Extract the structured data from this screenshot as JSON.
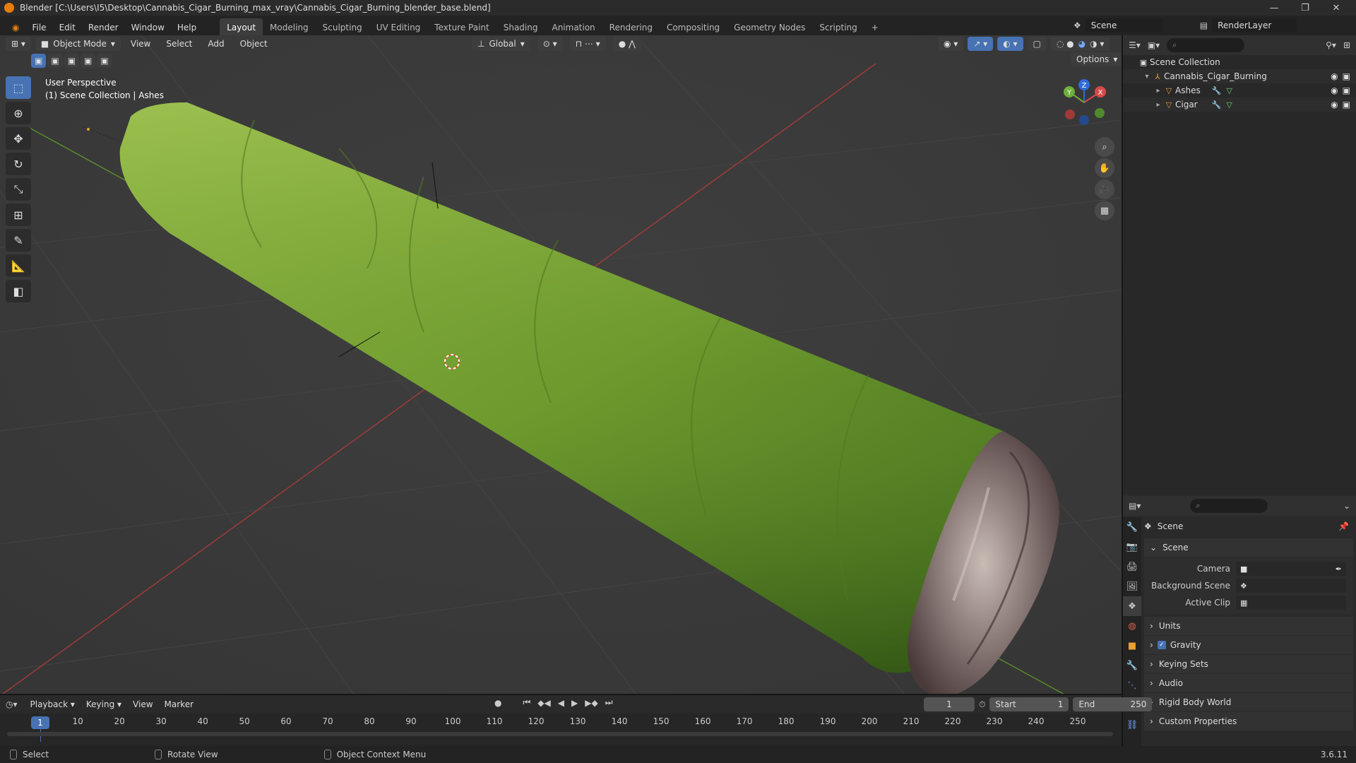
{
  "window": {
    "title": "Blender [C:\\Users\\I5\\Desktop\\Cannabis_Cigar_Burning_max_vray\\Cannabis_Cigar_Burning_blender_base.blend]"
  },
  "menu": [
    "File",
    "Edit",
    "Render",
    "Window",
    "Help"
  ],
  "workspaces": [
    "Layout",
    "Modeling",
    "Sculpting",
    "UV Editing",
    "Texture Paint",
    "Shading",
    "Animation",
    "Rendering",
    "Compositing",
    "Geometry Nodes",
    "Scripting"
  ],
  "active_workspace": "Layout",
  "scene_selector": "Scene",
  "view_layer": "RenderLayer",
  "viewport": {
    "mode": "Object Mode",
    "menus": [
      "View",
      "Select",
      "Add",
      "Object"
    ],
    "transform_orientation": "Global",
    "options_label": "Options",
    "perspective_label": "User Perspective",
    "collection_label": "(1) Scene Collection | Ashes",
    "gizmo_axes": [
      "X",
      "Y",
      "Z"
    ]
  },
  "outliner": {
    "root": "Scene Collection",
    "collection": "Cannabis_Cigar_Burning",
    "objects": [
      "Ashes",
      "Cigar"
    ]
  },
  "properties": {
    "context": "Scene",
    "section": "Scene",
    "fields": [
      {
        "label": "Camera",
        "value": ""
      },
      {
        "label": "Background Scene",
        "value": ""
      },
      {
        "label": "Active Clip",
        "value": ""
      }
    ],
    "panels": [
      "Units",
      "Gravity",
      "Keying Sets",
      "Audio",
      "Rigid Body World",
      "Custom Properties"
    ],
    "gravity_checked": true
  },
  "timeline": {
    "menus": [
      "Playback",
      "Keying",
      "View",
      "Marker"
    ],
    "current_frame": "1",
    "start_label": "Start",
    "start": "1",
    "end_label": "End",
    "end": "250",
    "ticks": [
      "1",
      "10",
      "20",
      "30",
      "40",
      "50",
      "60",
      "70",
      "80",
      "90",
      "100",
      "110",
      "120",
      "130",
      "140",
      "150",
      "160",
      "170",
      "180",
      "190",
      "200",
      "210",
      "220",
      "230",
      "240",
      "250"
    ]
  },
  "status": {
    "select": "Select",
    "rotate": "Rotate View",
    "context_menu": "Object Context Menu",
    "version": "3.6.11"
  }
}
